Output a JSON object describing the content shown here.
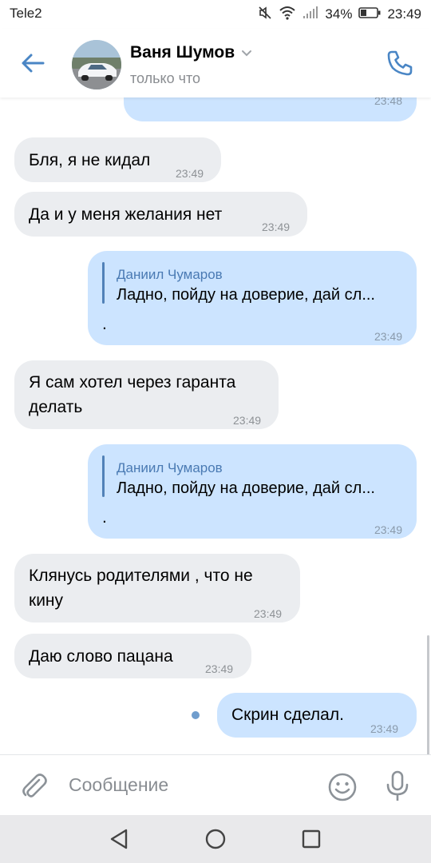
{
  "status_bar": {
    "carrier": "Tele2",
    "battery": "34%",
    "time": "23:49"
  },
  "header": {
    "name": "Ваня Шумов",
    "subtitle": "только что"
  },
  "messages": [
    {
      "direction": "out",
      "text": "",
      "time": "23:48"
    },
    {
      "direction": "in",
      "text": "Бля, я не кидал",
      "time": "23:49"
    },
    {
      "direction": "in",
      "text": "Да и у меня желания нет",
      "time": "23:49"
    },
    {
      "direction": "out",
      "reply_author": "Даниил Чумаров",
      "reply_text": "Ладно, пойду на доверие, дай сл...",
      "text": ".",
      "time": "23:49"
    },
    {
      "direction": "in",
      "text_line1": "Я сам хотел через гаранта",
      "text_line2": "делать",
      "time": "23:49"
    },
    {
      "direction": "out",
      "reply_author": "Даниил Чумаров",
      "reply_text": "Ладно, пойду на доверие, дай сл...",
      "text": ".",
      "time": "23:49"
    },
    {
      "direction": "in",
      "text_line1": "Клянусь родителями , что не",
      "text_line2": "кину",
      "time": "23:49"
    },
    {
      "direction": "in",
      "text": "Даю слово пацана",
      "time": "23:49"
    },
    {
      "direction": "out",
      "text": "Скрин сделал.",
      "time": "23:49",
      "unread": true
    }
  ],
  "composer": {
    "placeholder": "Сообщение"
  },
  "icons": {
    "back": "arrow-left-icon",
    "call": "phone-icon",
    "attach": "paperclip-icon",
    "emoji": "smile-icon",
    "voice": "microphone-icon"
  },
  "colors": {
    "accent": "#4a86c5",
    "outgoing_bubble": "#cce4ff",
    "incoming_bubble": "#ebedf0"
  }
}
